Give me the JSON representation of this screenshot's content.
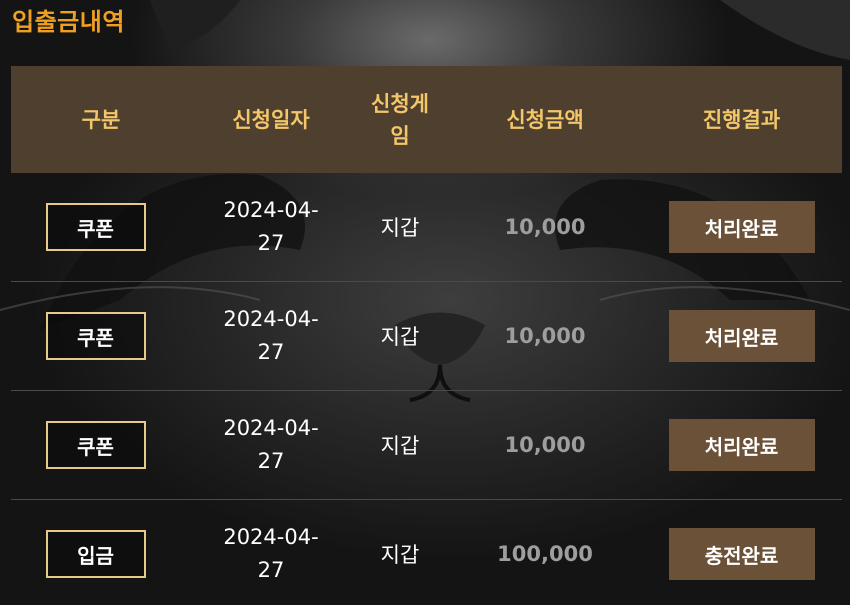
{
  "title": "입출금내역",
  "headers": {
    "type": "구분",
    "date": "신청일자",
    "game": "신청게임",
    "amount": "신청금액",
    "result": "진행결과"
  },
  "rows": [
    {
      "type": "쿠폰",
      "date": "2024-04-27",
      "game": "지갑",
      "amount": "10,000",
      "result": "처리완료"
    },
    {
      "type": "쿠폰",
      "date": "2024-04-27",
      "game": "지갑",
      "amount": "10,000",
      "result": "처리완료"
    },
    {
      "type": "쿠폰",
      "date": "2024-04-27",
      "game": "지갑",
      "amount": "10,000",
      "result": "처리완료"
    },
    {
      "type": "입금",
      "date": "2024-04-27",
      "game": "지갑",
      "amount": "100,000",
      "result": "충전완료"
    }
  ],
  "colors": {
    "title": "#f0a020",
    "header_bg": "#4e3f2e",
    "header_text": "#f3c66a",
    "type_border": "#e8c98c",
    "result_bg": "#6b5137",
    "amount_text": "#9e9e9e"
  }
}
